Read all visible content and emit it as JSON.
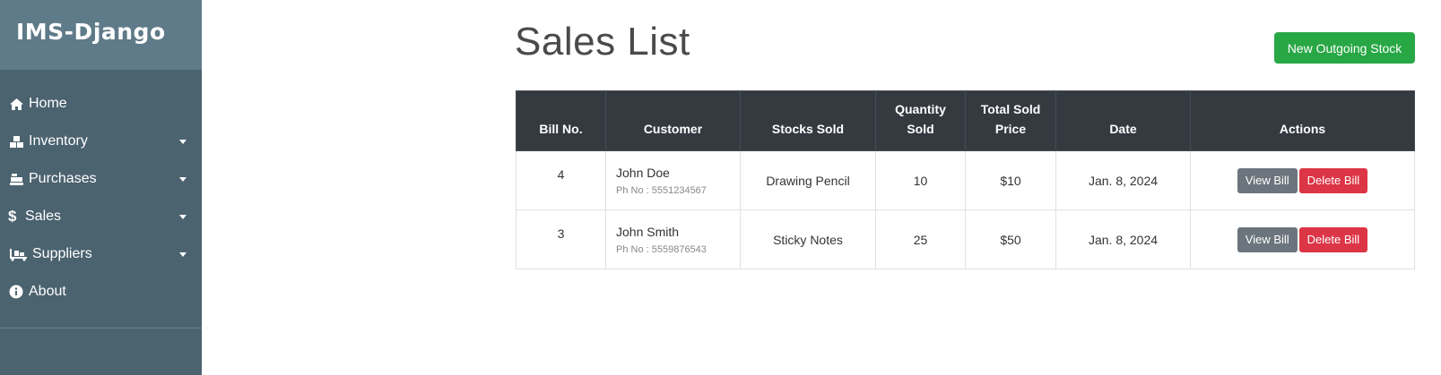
{
  "brand": "IMS-Django",
  "nav": [
    {
      "label": "Home",
      "icon": "home-icon",
      "dropdown": false
    },
    {
      "label": "Inventory",
      "icon": "boxes-icon",
      "dropdown": true
    },
    {
      "label": "Purchases",
      "icon": "cash-register-icon",
      "dropdown": true
    },
    {
      "label": "Sales",
      "icon": "dollar-icon",
      "dropdown": true
    },
    {
      "label": "Suppliers",
      "icon": "truck-loading-icon",
      "dropdown": true
    },
    {
      "label": "About",
      "icon": "info-icon",
      "dropdown": false
    }
  ],
  "page": {
    "title": "Sales List",
    "new_button": "New Outgoing Stock"
  },
  "table": {
    "headers": [
      "Bill No.",
      "Customer",
      "Stocks Sold",
      "Quantity Sold",
      "Total Sold Price",
      "Date",
      "Actions"
    ],
    "rows": [
      {
        "bill_no": "4",
        "customer": "John Doe",
        "phone": "Ph No : 5551234567",
        "stock": "Drawing Pencil",
        "quantity": "10",
        "price": "$10",
        "date": "Jan. 8, 2024",
        "view": "View Bill",
        "delete": "Delete Bill"
      },
      {
        "bill_no": "3",
        "customer": "John Smith",
        "phone": "Ph No : 5559876543",
        "stock": "Sticky Notes",
        "quantity": "25",
        "price": "$50",
        "date": "Jan. 8, 2024",
        "view": "View Bill",
        "delete": "Delete Bill"
      }
    ]
  },
  "colors": {
    "sidebar": "#4b626f",
    "brand_bar": "#5f7a88",
    "header": "#343a40",
    "success": "#28a745",
    "secondary": "#6c757d",
    "danger": "#dc3545"
  }
}
